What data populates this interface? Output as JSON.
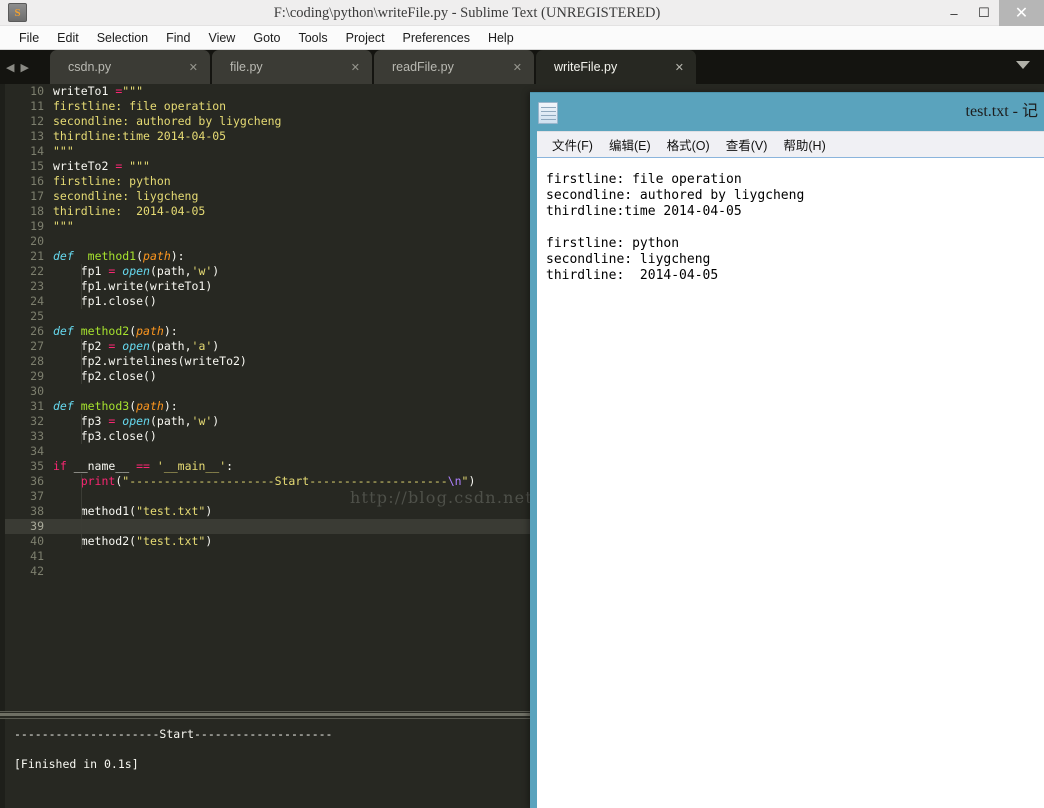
{
  "sublime": {
    "title": "F:\\coding\\python\\writeFile.py - Sublime Text (UNREGISTERED)",
    "app_icon_glyph": "S",
    "window_controls": {
      "minimize": "–",
      "maximize": "☐",
      "close": "✕"
    },
    "menu": [
      "File",
      "Edit",
      "Selection",
      "Find",
      "View",
      "Goto",
      "Tools",
      "Project",
      "Preferences",
      "Help"
    ],
    "tab_nav": {
      "prev": "◀",
      "next": "▶"
    },
    "tabs": [
      {
        "label": "csdn.py",
        "close": "✕",
        "active": false
      },
      {
        "label": "file.py",
        "close": "✕",
        "active": false
      },
      {
        "label": "readFile.py",
        "close": "✕",
        "active": false
      },
      {
        "label": "writeFile.py",
        "close": "✕",
        "active": true
      }
    ],
    "current_line": 39,
    "first_line_number": 10,
    "last_line_number": 42,
    "console": "---------------------Start--------------------\n\n[Finished in 0.1s]",
    "watermark": "http://blog.csdn.net/liygcheng"
  },
  "code_lines": [
    {
      "n": 10,
      "tokens": [
        {
          "t": "plain",
          "v": "writeTo1 "
        },
        {
          "t": "op",
          "v": "="
        },
        {
          "t": "str",
          "v": "\"\"\""
        }
      ]
    },
    {
      "n": 11,
      "tokens": [
        {
          "t": "str",
          "v": "firstline: file operation"
        }
      ]
    },
    {
      "n": 12,
      "tokens": [
        {
          "t": "str",
          "v": "secondline: authored by liygcheng"
        }
      ]
    },
    {
      "n": 13,
      "tokens": [
        {
          "t": "str",
          "v": "thirdline:time 2014-04-05"
        }
      ]
    },
    {
      "n": 14,
      "tokens": [
        {
          "t": "str",
          "v": "\"\"\""
        }
      ]
    },
    {
      "n": 15,
      "tokens": [
        {
          "t": "plain",
          "v": "writeTo2 "
        },
        {
          "t": "op",
          "v": "="
        },
        {
          "t": "str",
          "v": " \"\"\""
        }
      ]
    },
    {
      "n": 16,
      "tokens": [
        {
          "t": "str",
          "v": "firstline: python"
        }
      ]
    },
    {
      "n": 17,
      "tokens": [
        {
          "t": "str",
          "v": "secondline: liygcheng"
        }
      ]
    },
    {
      "n": 18,
      "tokens": [
        {
          "t": "str",
          "v": "thirdline:  2014-04-05"
        }
      ]
    },
    {
      "n": 19,
      "tokens": [
        {
          "t": "str",
          "v": "\"\"\""
        }
      ]
    },
    {
      "n": 20,
      "tokens": []
    },
    {
      "n": 21,
      "tokens": [
        {
          "t": "def",
          "v": "def"
        },
        {
          "t": "plain",
          "v": "  "
        },
        {
          "t": "fn",
          "v": "method1"
        },
        {
          "t": "plain",
          "v": "("
        },
        {
          "t": "param",
          "v": "path"
        },
        {
          "t": "plain",
          "v": "):"
        }
      ]
    },
    {
      "n": 22,
      "tokens": [
        {
          "t": "plain",
          "v": "    fp1 "
        },
        {
          "t": "op",
          "v": "="
        },
        {
          "t": "plain",
          "v": " "
        },
        {
          "t": "builtin",
          "v": "open"
        },
        {
          "t": "plain",
          "v": "(path,"
        },
        {
          "t": "str",
          "v": "'w'"
        },
        {
          "t": "plain",
          "v": ")"
        }
      ]
    },
    {
      "n": 23,
      "tokens": [
        {
          "t": "plain",
          "v": "    fp1.write(writeTo1)"
        }
      ]
    },
    {
      "n": 24,
      "tokens": [
        {
          "t": "plain",
          "v": "    fp1.close()"
        }
      ]
    },
    {
      "n": 25,
      "tokens": []
    },
    {
      "n": 26,
      "tokens": [
        {
          "t": "def",
          "v": "def"
        },
        {
          "t": "plain",
          "v": " "
        },
        {
          "t": "fn",
          "v": "method2"
        },
        {
          "t": "plain",
          "v": "("
        },
        {
          "t": "param",
          "v": "path"
        },
        {
          "t": "plain",
          "v": "):"
        }
      ]
    },
    {
      "n": 27,
      "tokens": [
        {
          "t": "plain",
          "v": "    fp2 "
        },
        {
          "t": "op",
          "v": "="
        },
        {
          "t": "plain",
          "v": " "
        },
        {
          "t": "builtin",
          "v": "open"
        },
        {
          "t": "plain",
          "v": "(path,"
        },
        {
          "t": "str",
          "v": "'a'"
        },
        {
          "t": "plain",
          "v": ")"
        }
      ]
    },
    {
      "n": 28,
      "tokens": [
        {
          "t": "plain",
          "v": "    fp2.writelines(writeTo2)"
        }
      ]
    },
    {
      "n": 29,
      "tokens": [
        {
          "t": "plain",
          "v": "    fp2.close()"
        }
      ]
    },
    {
      "n": 30,
      "tokens": []
    },
    {
      "n": 31,
      "tokens": [
        {
          "t": "def",
          "v": "def"
        },
        {
          "t": "plain",
          "v": " "
        },
        {
          "t": "fn",
          "v": "method3"
        },
        {
          "t": "plain",
          "v": "("
        },
        {
          "t": "param",
          "v": "path"
        },
        {
          "t": "plain",
          "v": "):"
        }
      ]
    },
    {
      "n": 32,
      "tokens": [
        {
          "t": "plain",
          "v": "    fp3 "
        },
        {
          "t": "op",
          "v": "="
        },
        {
          "t": "plain",
          "v": " "
        },
        {
          "t": "builtin",
          "v": "open"
        },
        {
          "t": "plain",
          "v": "(path,"
        },
        {
          "t": "str",
          "v": "'w'"
        },
        {
          "t": "plain",
          "v": ")"
        }
      ]
    },
    {
      "n": 33,
      "tokens": [
        {
          "t": "plain",
          "v": "    fp3.close()"
        }
      ]
    },
    {
      "n": 34,
      "tokens": []
    },
    {
      "n": 35,
      "tokens": [
        {
          "t": "kw",
          "v": "if"
        },
        {
          "t": "plain",
          "v": " __name__ "
        },
        {
          "t": "op",
          "v": "=="
        },
        {
          "t": "plain",
          "v": " "
        },
        {
          "t": "str",
          "v": "'__main__'"
        },
        {
          "t": "plain",
          "v": ":"
        }
      ]
    },
    {
      "n": 36,
      "tokens": [
        {
          "t": "plain",
          "v": "    "
        },
        {
          "t": "op",
          "v": "print"
        },
        {
          "t": "plain",
          "v": "("
        },
        {
          "t": "str",
          "v": "\"---------------------Start--------------------"
        },
        {
          "t": "esc",
          "v": "\\n"
        },
        {
          "t": "str",
          "v": "\""
        },
        {
          "t": "plain",
          "v": ")"
        }
      ]
    },
    {
      "n": 37,
      "tokens": []
    },
    {
      "n": 38,
      "tokens": [
        {
          "t": "plain",
          "v": "    method1("
        },
        {
          "t": "str",
          "v": "\"test.txt\""
        },
        {
          "t": "plain",
          "v": ")"
        }
      ]
    },
    {
      "n": 39,
      "tokens": []
    },
    {
      "n": 40,
      "tokens": [
        {
          "t": "plain",
          "v": "    method2("
        },
        {
          "t": "str",
          "v": "\"test.txt\""
        },
        {
          "t": "plain",
          "v": ")"
        }
      ]
    },
    {
      "n": 41,
      "tokens": []
    },
    {
      "n": 42,
      "tokens": []
    }
  ],
  "notepad": {
    "title": "test.txt - 记",
    "icon": "notepad-icon",
    "menu": [
      "文件(F)",
      "编辑(E)",
      "格式(O)",
      "查看(V)",
      "帮助(H)"
    ],
    "content": "firstline: file operation\nsecondline: authored by liygcheng\nthirdline:time 2014-04-05\n\nfirstline: python\nsecondline: liygcheng\nthirdline:  2014-04-05"
  },
  "colors": {
    "editor_bg": "#272822",
    "accent_string": "#e6db74",
    "accent_keyword": "#f92672",
    "accent_function": "#a6e22e",
    "accent_type": "#66d9ef",
    "accent_param": "#fd971f",
    "notepad_chrome": "#5aa3bd"
  }
}
